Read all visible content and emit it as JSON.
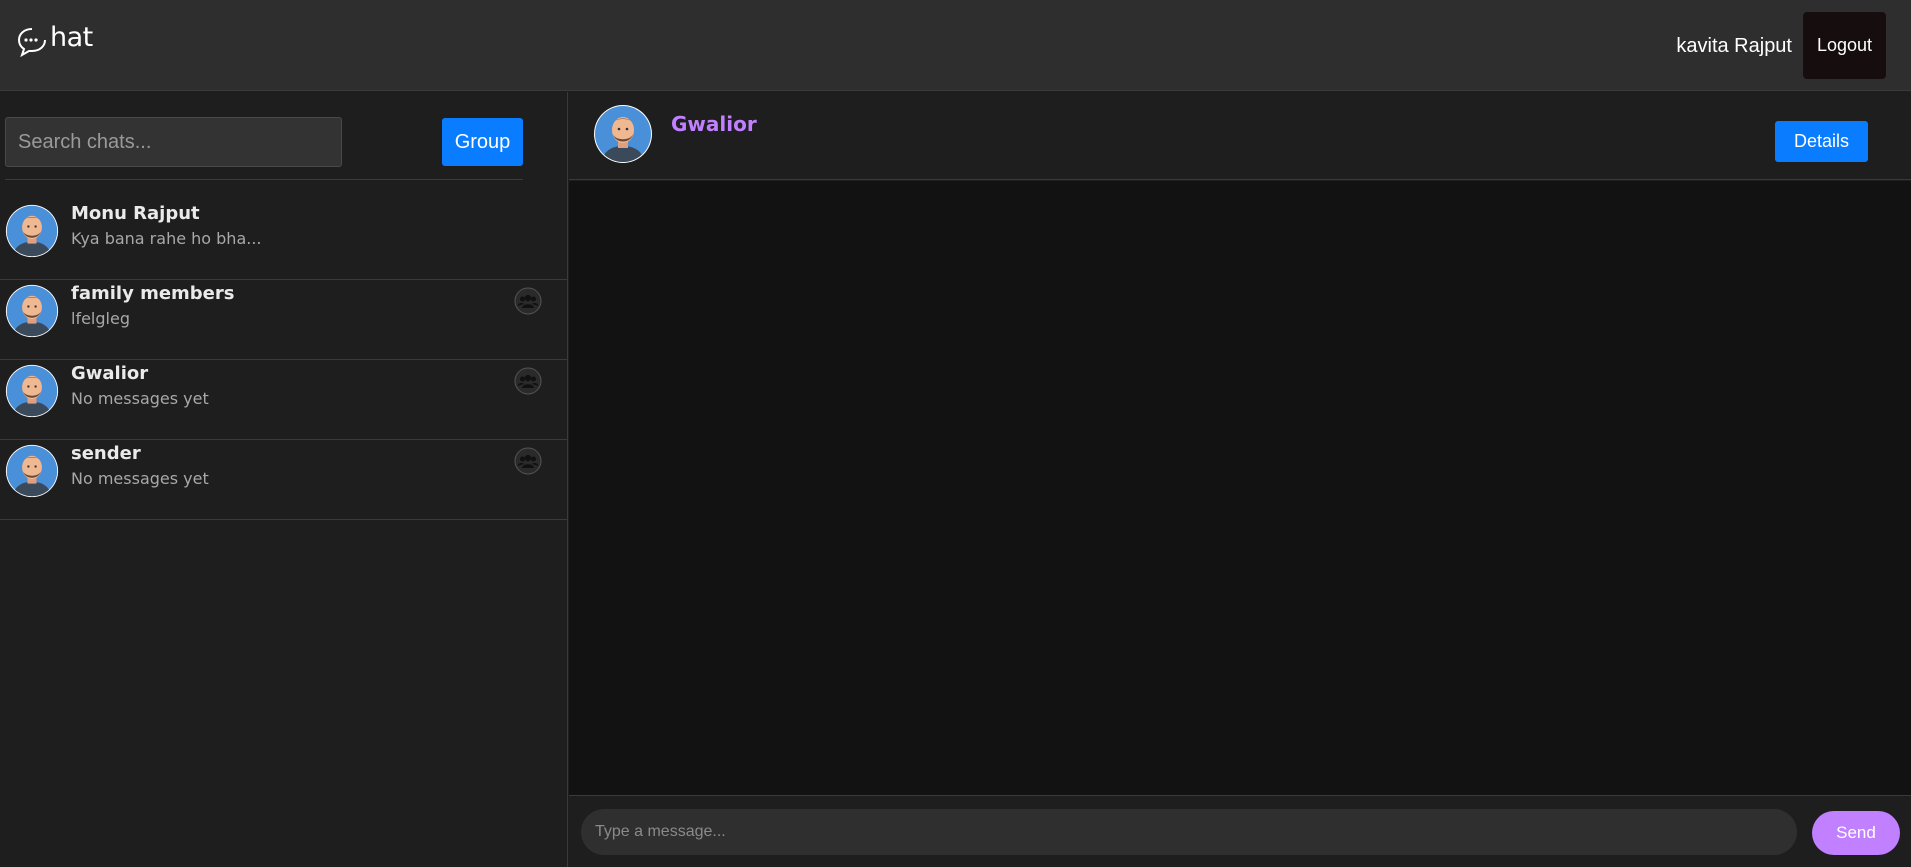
{
  "header": {
    "logo_text": "hat",
    "username": "kavita Rajput",
    "logout_label": "Logout"
  },
  "sidebar": {
    "search_placeholder": "Search chats...",
    "group_button_label": "Group",
    "chats": [
      {
        "name": "Monu Rajput",
        "preview": "Kya bana rahe ho bha...",
        "is_group": false
      },
      {
        "name": "family members",
        "preview": "lfelgleg",
        "is_group": true
      },
      {
        "name": "Gwalior",
        "preview": "No messages yet",
        "is_group": true
      },
      {
        "name": "sender",
        "preview": "No messages yet",
        "is_group": true
      }
    ]
  },
  "chat": {
    "title": "Gwalior",
    "details_label": "Details",
    "message_placeholder": "Type a message...",
    "send_label": "Send"
  },
  "colors": {
    "accent": "#c080ff",
    "primary_button": "#0a7cff",
    "topbar": "#2e2e2e",
    "panel": "#1e1e1e",
    "message_area": "#121212"
  }
}
